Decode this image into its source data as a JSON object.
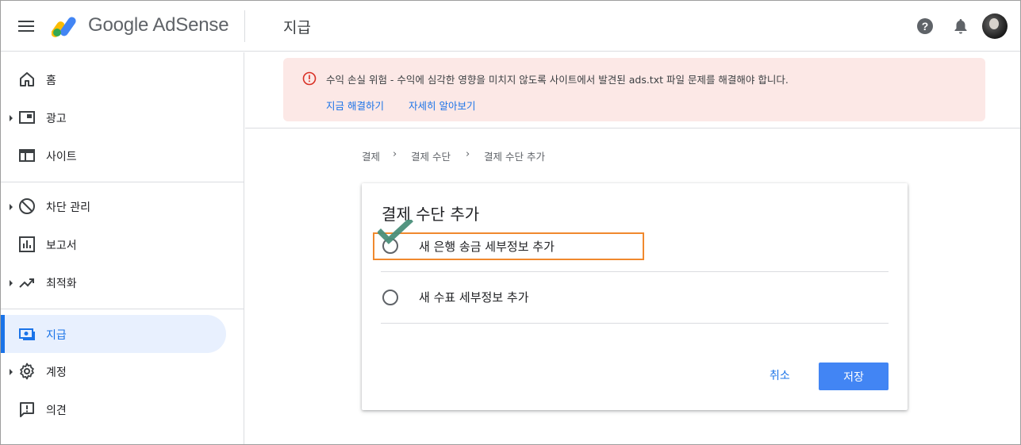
{
  "header": {
    "product_name": "Google AdSense",
    "page_title": "지급",
    "icons": [
      "menu-icon",
      "help-icon",
      "notifications-icon",
      "avatar"
    ]
  },
  "sidebar": {
    "items": [
      {
        "label": "홈",
        "icon": "home-icon",
        "expandable": false,
        "active": false
      },
      {
        "label": "광고",
        "icon": "ads-icon",
        "expandable": true,
        "active": false
      },
      {
        "label": "사이트",
        "icon": "sites-icon",
        "expandable": false,
        "active": false
      },
      {
        "label": "차단 관리",
        "icon": "block-icon",
        "expandable": true,
        "active": false
      },
      {
        "label": "보고서",
        "icon": "reports-icon",
        "expandable": false,
        "active": false
      },
      {
        "label": "최적화",
        "icon": "trending-up-icon",
        "expandable": true,
        "active": false
      },
      {
        "label": "지급",
        "icon": "payments-icon",
        "expandable": false,
        "active": true
      },
      {
        "label": "계정",
        "icon": "gear-icon",
        "expandable": true,
        "active": false
      },
      {
        "label": "의견",
        "icon": "feedback-icon",
        "expandable": false,
        "active": false
      }
    ]
  },
  "alert": {
    "message": "수익 손실 위험 - 수익에 심각한 영향을 미치지 않도록 사이트에서 발견된 ads.txt 파일 문제를 해결해야 합니다.",
    "fix_link": "지금 해결하기",
    "learn_link": "자세히 알아보기",
    "color": "#fce8e6"
  },
  "breadcrumb": [
    "결제",
    "결제 수단",
    "결제 수단 추가"
  ],
  "card": {
    "title": "결제 수단 추가",
    "options": [
      {
        "label": "새 은행 송금 세부정보 추가",
        "selected": false
      },
      {
        "label": "새 수표 세부정보 추가",
        "selected": false
      }
    ],
    "cancel_label": "취소",
    "save_label": "저장"
  },
  "colors": {
    "accent": "#1a73e8",
    "save_button": "#4285f4",
    "highlight_box": "#f0892e",
    "checkmark": "#4a8f7a"
  }
}
